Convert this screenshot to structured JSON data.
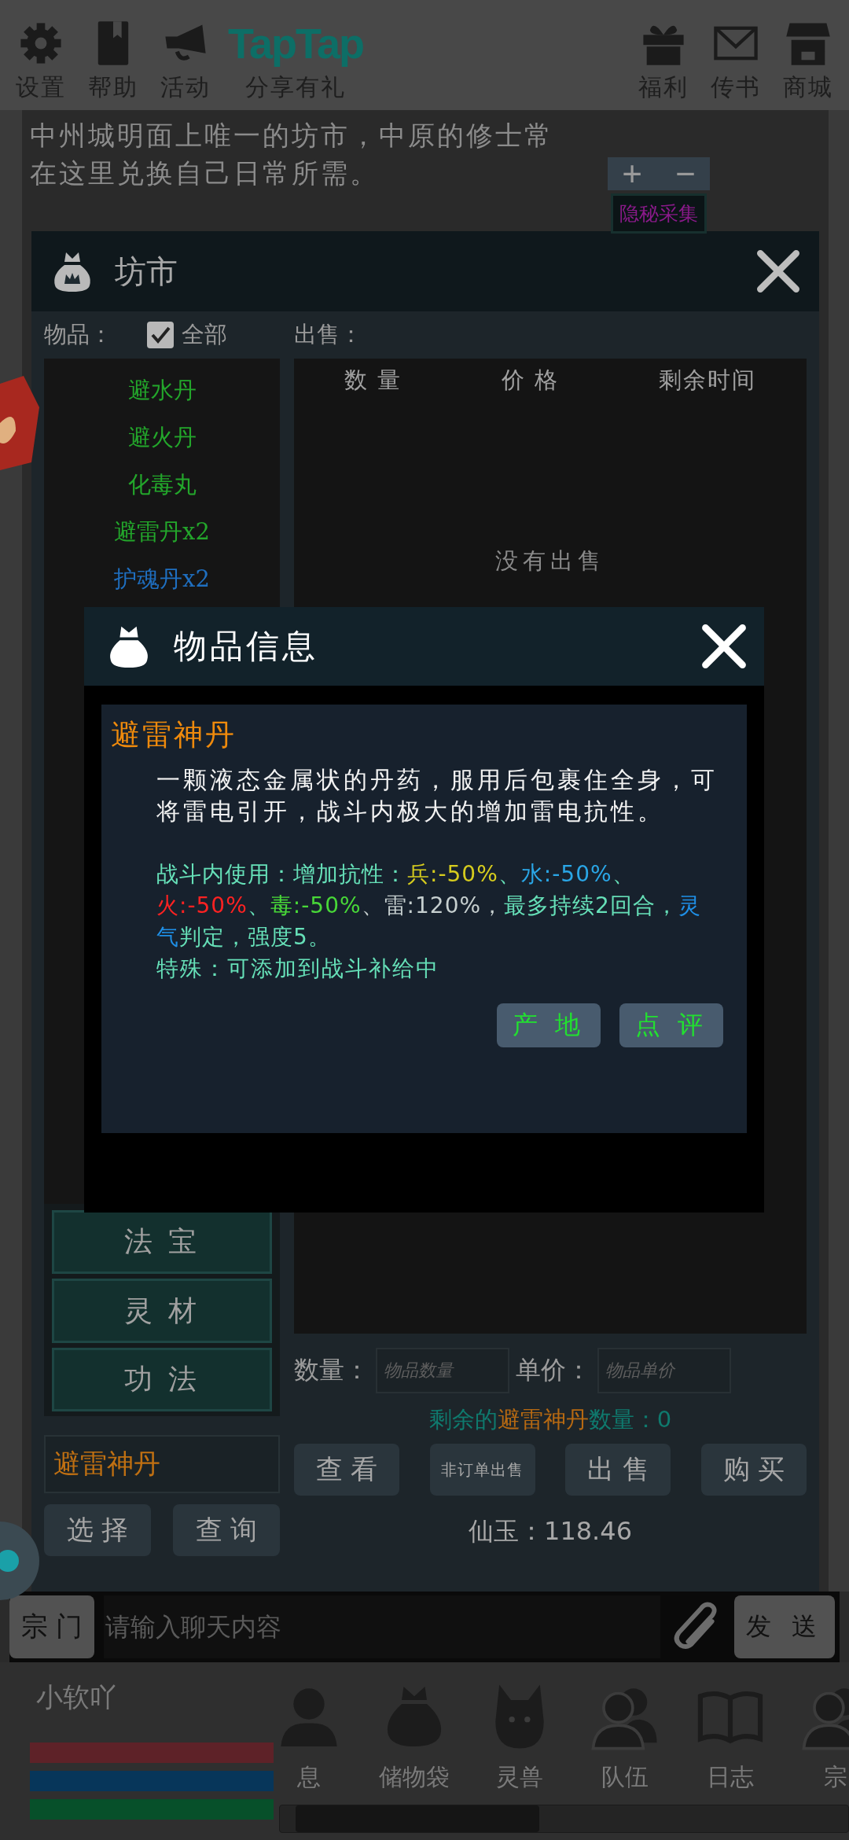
{
  "top_bar": {
    "left_items": [
      {
        "label": "设置",
        "kind": "gear"
      },
      {
        "label": "帮助",
        "kind": "book"
      },
      {
        "label": "活动",
        "kind": "megaphone"
      }
    ],
    "logo": "TapTap",
    "share_label": "分享有礼",
    "right_items": [
      {
        "label": "福利",
        "kind": "gift"
      },
      {
        "label": "传书",
        "kind": "mail"
      },
      {
        "label": "商城",
        "kind": "shop"
      }
    ]
  },
  "description": "中州城明面上唯一的坊市，中原的修士常在这里兑换自己日常所需。",
  "widget": {
    "plus": "+",
    "minus": "−",
    "label": "隐秘采集"
  },
  "market": {
    "title": "坊市",
    "items_label": "物品：",
    "all_checkbox": {
      "label": "全部",
      "checked": true
    },
    "sell_label": "出售：",
    "items": [
      {
        "name": "避水丹",
        "color": "#23a62b"
      },
      {
        "name": "避火丹",
        "color": "#23a62b"
      },
      {
        "name": "化毒丸",
        "color": "#23a62b"
      },
      {
        "name": "避雷丹x2",
        "color": "#23a62b"
      },
      {
        "name": "护魂丹x2",
        "color": "#1f6fc0"
      }
    ],
    "columns": [
      "数 量",
      "价 格",
      "剩余时间"
    ],
    "empty_text": "没有出售",
    "categories": [
      "法 宝",
      "灵 材",
      "功 法"
    ],
    "selected_item": "避雷神丹",
    "left_buttons": [
      "选 择",
      "查 询"
    ],
    "quantity_label": "数量：",
    "quantity_placeholder": "物品数量",
    "price_label": "单价：",
    "price_placeholder": "物品单价",
    "remaining": {
      "prefix": "剩余的",
      "item": "避雷神丹",
      "suffix": "数量：0"
    },
    "actions": [
      "查 看",
      "非订单出售",
      "出 售",
      "购 买"
    ],
    "currency": "仙玉：118.46"
  },
  "item_dialog": {
    "title": "物品信息",
    "item_name": "避雷神丹",
    "description": "一颗液态金属状的丹药，服用后包裹住全身，可将雷电引开，战斗内极大的增加雷电抗性。",
    "effect_segments": [
      {
        "text": "战斗内使用：增加抗性：",
        "color": "#66e0b8"
      },
      {
        "text": "兵:-50%",
        "color": "#d6cc1e"
      },
      {
        "text": "、",
        "color": "#66e0b8"
      },
      {
        "text": "水:-50%",
        "color": "#2aa6e6"
      },
      {
        "text": "、",
        "color": "#66e0b8"
      },
      {
        "text": "火:-50%",
        "color": "#ff2222"
      },
      {
        "text": "、",
        "color": "#66e0b8"
      },
      {
        "text": "毒:-50%",
        "color": "#48d838"
      },
      {
        "text": "、雷:120%，",
        "color": "#c6cfcf"
      },
      {
        "text": "最多持续2回合，",
        "color": "#66e0b8"
      },
      {
        "text": "灵气",
        "color": "#1f8fe6"
      },
      {
        "text": "判定，强度5。",
        "color": "#66e0b8"
      }
    ],
    "special": "特殊：可添加到战斗补给中",
    "buttons": [
      "产 地",
      "点 评"
    ]
  },
  "chat": {
    "channel": "宗 门",
    "placeholder": "请输入聊天内容",
    "send": "发 送"
  },
  "player": {
    "name": "小软吖",
    "bars": [
      {
        "color": "#5e2228",
        "level": 1
      },
      {
        "color": "#07365a",
        "level": 1
      },
      {
        "color": "#07502a",
        "level": 1
      }
    ]
  },
  "nav": [
    {
      "label": "息",
      "kind": "person"
    },
    {
      "label": "储物袋",
      "kind": "bag"
    },
    {
      "label": "灵兽",
      "kind": "beast"
    },
    {
      "label": "队伍",
      "kind": "team"
    },
    {
      "label": "日志",
      "kind": "journal"
    },
    {
      "label": "宗",
      "kind": "team"
    }
  ]
}
